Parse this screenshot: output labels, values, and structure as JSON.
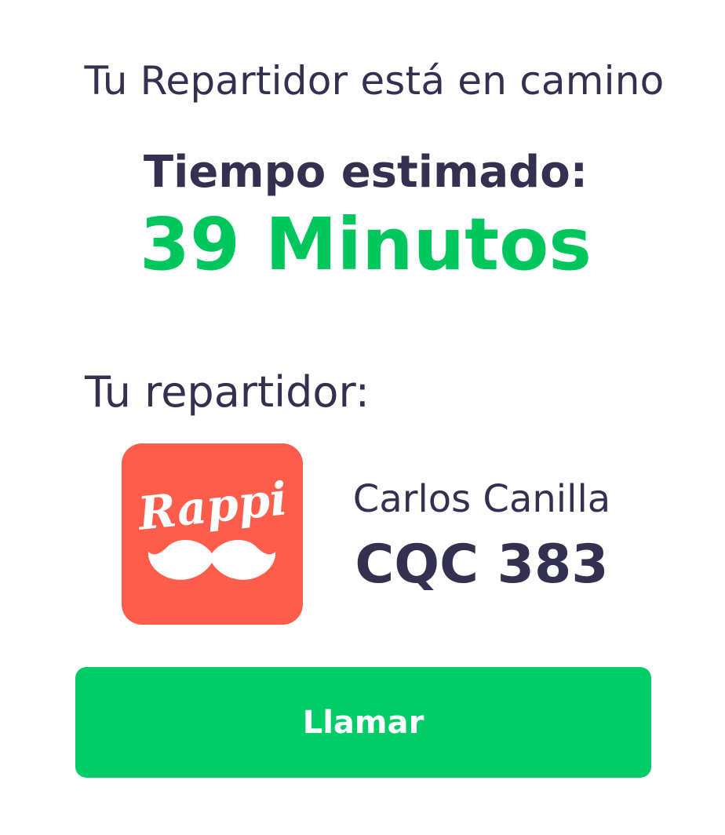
{
  "header": {
    "status_text": "Tu Repartidor está en camino"
  },
  "eta": {
    "label": "Tiempo estimado:",
    "value": "39 Minutos"
  },
  "courier": {
    "section_label": "Tu repartidor:",
    "logo_text": "Rappi",
    "logo_icon": "rappi-mustache-logo",
    "name": "Carlos Canilla",
    "plate": "CQC 383"
  },
  "actions": {
    "call_label": "Llamar"
  },
  "colors": {
    "text_primary": "#34304f",
    "accent_green": "#00c65e",
    "button_green": "#00cc68",
    "logo_bg": "#fe5d4c",
    "white": "#ffffff"
  }
}
